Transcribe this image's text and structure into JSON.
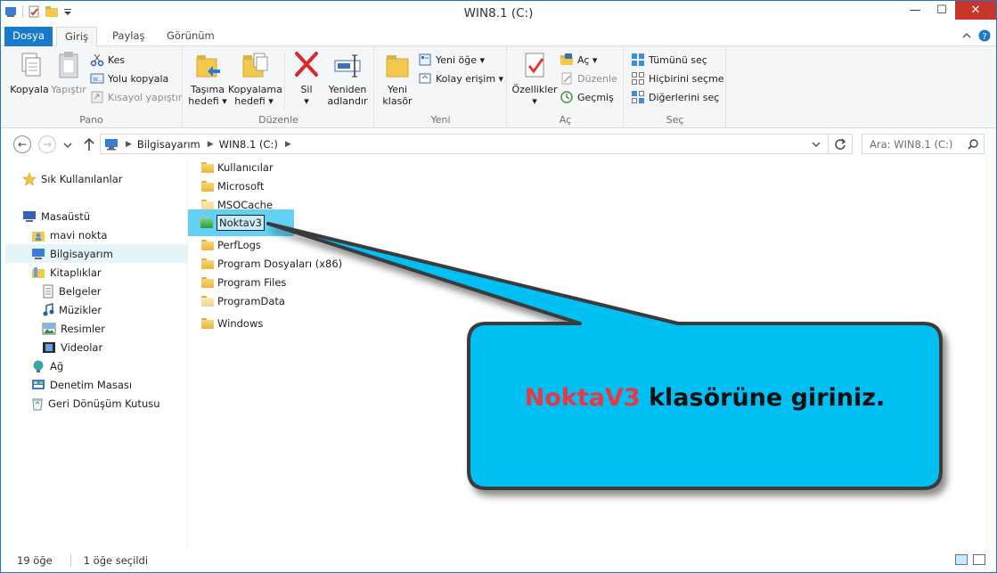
{
  "window": {
    "title": "WIN8.1 (C:)",
    "minimize": "—",
    "maximize": "☐",
    "close": "✕"
  },
  "menu": {
    "tabs": [
      "Dosya",
      "Giriş",
      "Paylaş",
      "Görünüm"
    ],
    "active_tab": "Giriş"
  },
  "ribbon": {
    "pano": {
      "label": "Pano",
      "copy": "Kopyala",
      "paste": "Yapıştır",
      "cut": "Kes",
      "copy_path": "Yolu kopyala",
      "paste_shortcut": "Kısayol yapıştır"
    },
    "duzenle": {
      "label": "Düzenle",
      "move_to_1": "Taşıma",
      "move_to_2": "hedefi ▾",
      "copy_to_1": "Kopyalama",
      "copy_to_2": "hedefi ▾",
      "delete": "Sil",
      "delete_arrow": "▾",
      "rename_1": "Yeniden",
      "rename_2": "adlandır"
    },
    "yeni": {
      "label": "Yeni",
      "new_folder_1": "Yeni",
      "new_folder_2": "klasör",
      "new_item": "Yeni öğe ▾",
      "easy_access": "Kolay erişim ▾"
    },
    "ac": {
      "label": "Aç",
      "properties": "Özellikler",
      "properties_arrow": "▾",
      "open": "Aç ▾",
      "edit": "Düzenle",
      "history": "Geçmiş"
    },
    "sec": {
      "label": "Seç",
      "select_all": "Tümünü seç",
      "select_none": "Hiçbirini seçme",
      "invert": "Diğerlerini seç"
    }
  },
  "address": {
    "crumbs": [
      "Bilgisayarım",
      "WIN8.1 (C:)"
    ],
    "search_placeholder": "Ara: WIN8.1 (C:)"
  },
  "nav": {
    "favorites": "Sık Kullanılanlar",
    "desktop": "Masaüstü",
    "user": "mavi nokta",
    "computer": "Bilgisayarım",
    "libraries": "Kitaplıklar",
    "documents": "Belgeler",
    "music": "Müzikler",
    "pictures": "Resimler",
    "videos": "Videolar",
    "network": "Ağ",
    "control_panel": "Denetim Masası",
    "recycle_bin": "Geri Dönüşüm Kutusu"
  },
  "files": [
    {
      "name": "Kullanıcılar",
      "style": "normal"
    },
    {
      "name": "Microsoft",
      "style": "normal"
    },
    {
      "name": "MSOCache",
      "style": "pale"
    },
    {
      "name": "Noktav3",
      "style": "green"
    },
    {
      "name": "PerfLogs",
      "style": "normal"
    },
    {
      "name": "Program Dosyaları (x86)",
      "style": "normal"
    },
    {
      "name": "Program Files",
      "style": "normal"
    },
    {
      "name": "ProgramData",
      "style": "pale"
    },
    {
      "name": "Windows",
      "style": "normal"
    }
  ],
  "status": {
    "item_count": "19 öğe",
    "selected": "1 öğe seçildi"
  },
  "callout": {
    "highlight": "NoktaV3",
    "text": " klasörüne giriniz."
  },
  "colors": {
    "accent": "#1979ca",
    "selection": "#62d1f5",
    "callout_fill": "#00bff3",
    "callout_highlight": "#e63946"
  }
}
